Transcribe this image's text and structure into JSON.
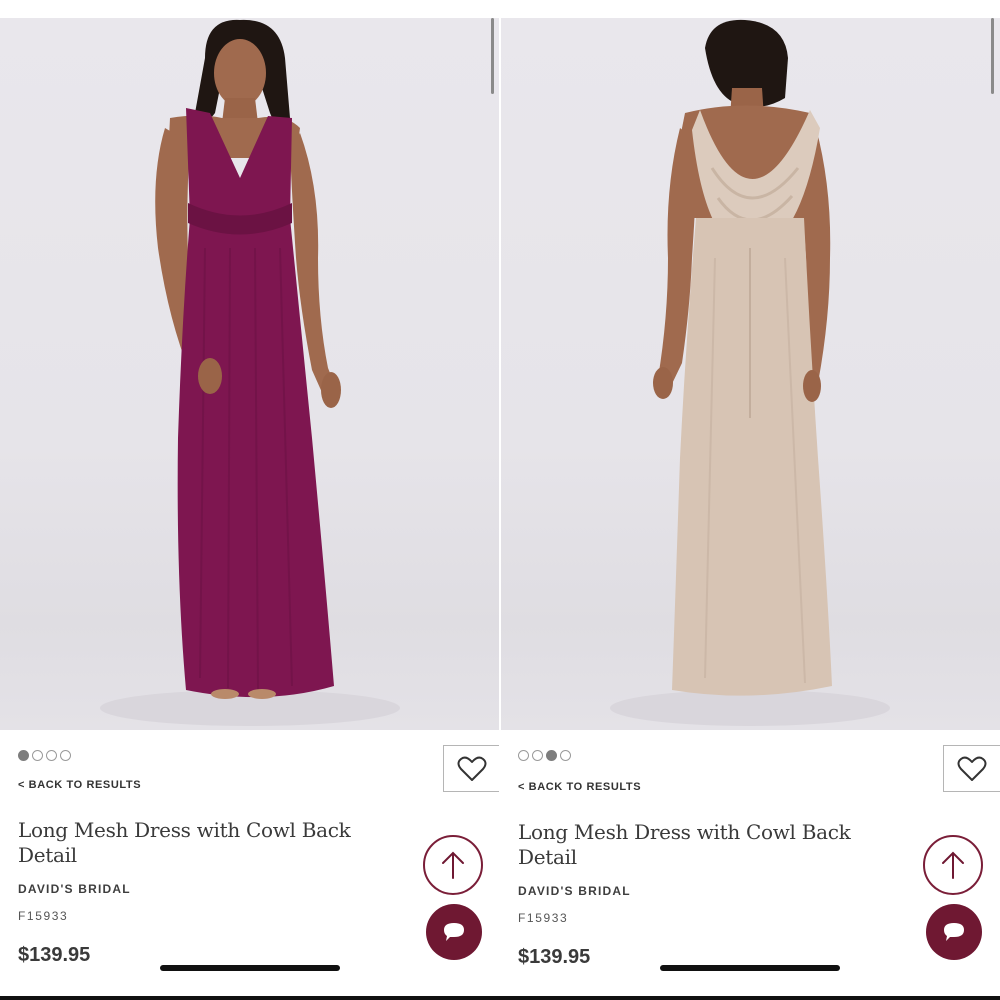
{
  "panels": [
    {
      "id": "left",
      "image": {
        "dress_color": "#7e1650",
        "view": "front"
      },
      "carousel": {
        "total": 4,
        "active_index": 0
      },
      "back_link": "< BACK TO RESULTS",
      "product": {
        "title": "Long Mesh Dress with Cowl Back Detail",
        "brand": "DAVID'S BRIDAL",
        "sku": "F15933",
        "price": "$139.95"
      },
      "icons": {
        "favorite": "heart-icon",
        "scroll_top": "arrow-up-icon",
        "chat": "chat-bubble-icon"
      }
    },
    {
      "id": "right",
      "image": {
        "dress_color": "#d7c4b4",
        "view": "back"
      },
      "carousel": {
        "total": 4,
        "active_index": 2
      },
      "back_link": "< BACK TO RESULTS",
      "product": {
        "title": "Long Mesh Dress with Cowl Back Detail",
        "brand": "DAVID'S BRIDAL",
        "sku": "F15933",
        "price": "$139.95"
      },
      "icons": {
        "favorite": "heart-icon",
        "scroll_top": "arrow-up-icon",
        "chat": "chat-bubble-icon"
      }
    }
  ],
  "colors": {
    "brand_accent": "#6f1832",
    "text": "#3a3a3a"
  }
}
